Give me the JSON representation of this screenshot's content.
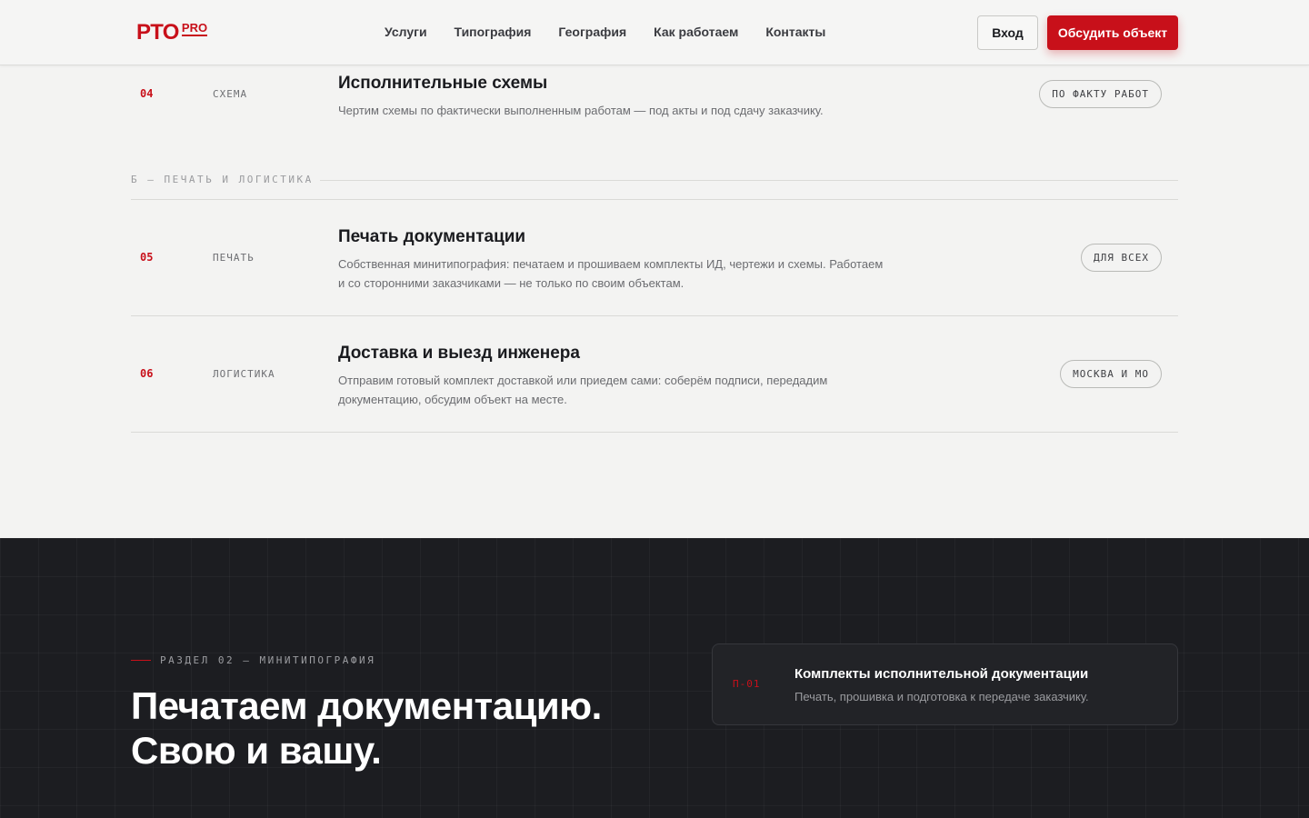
{
  "header": {
    "logo_main": "РТО",
    "logo_pro": "PRO",
    "nav": [
      "Услуги",
      "Типография",
      "География",
      "Как работаем",
      "Контакты"
    ],
    "login_label": "Вход",
    "cta_label": "Обсудить объект"
  },
  "services": {
    "row04": {
      "num": "04",
      "cat": "СХЕМА",
      "title": "Исполнительные схемы",
      "desc": "Чертим схемы по фактически выполненным работам — под акты и под сдачу заказчику.",
      "tag": "ПО ФАКТУ РАБОТ"
    },
    "section_b": "Б — ПЕЧАТЬ И ЛОГИСТИКА",
    "row05": {
      "num": "05",
      "cat": "ПЕЧАТЬ",
      "title": "Печать документации",
      "desc": "Собственная минитипография: печатаем и прошиваем комплекты ИД, чертежи и схемы. Работаем и со сторонними заказчиками — не только по своим объектам.",
      "tag": "ДЛЯ ВСЕХ"
    },
    "row06": {
      "num": "06",
      "cat": "ЛОГИСТИКА",
      "title": "Доставка и выезд инженера",
      "desc": "Отправим готовый комплект доставкой или приедем сами: соберём подписи, передадим документацию, обсудим объект на месте.",
      "tag": "МОСКВА И МО"
    }
  },
  "print_section": {
    "eyebrow": "РАЗДЕЛ 02 — МИНИТИПОГРАФИЯ",
    "headline_1": "Печатаем документацию.",
    "headline_2": "Свою и вашу.",
    "card": {
      "code": "П-01",
      "title": "Комплекты исполнительной документации",
      "desc": "Печать, прошивка и подготовка к передаче заказчику."
    }
  },
  "colors": {
    "accent": "#c8101a",
    "dark_bg": "#1c1d21",
    "light_bg": "#f3f3f2"
  }
}
